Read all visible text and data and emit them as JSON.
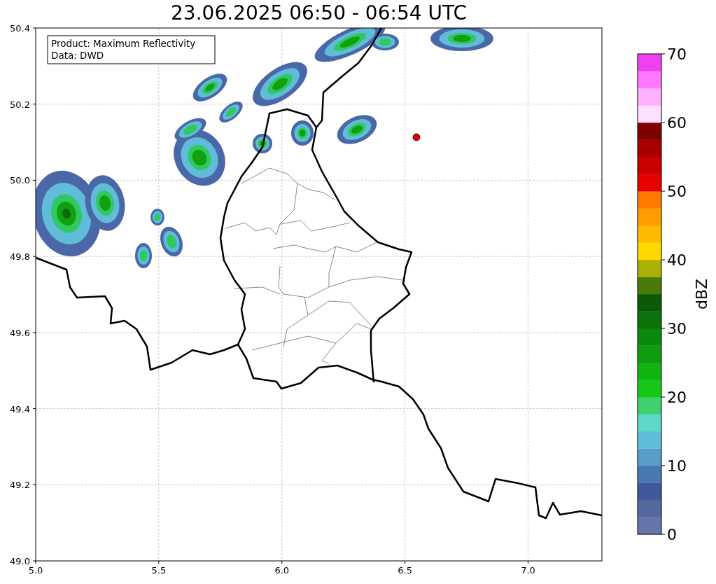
{
  "title": "23.06.2025 06:50 - 06:54 UTC",
  "legend": [
    "Product: Maximum Reflectivity",
    "Data: DWD"
  ],
  "x_axis": {
    "ticks": [
      "5.0",
      "5.5",
      "6.0",
      "6.5",
      "7.0"
    ]
  },
  "y_axis": {
    "ticks": [
      "50.4",
      "50.2",
      "50.0",
      "49.8",
      "49.6",
      "49.4",
      "49.2",
      "49.0"
    ]
  },
  "colorbar": {
    "label": "dBZ",
    "ticks": [
      "70",
      "60",
      "50",
      "40",
      "30",
      "20",
      "10",
      "0"
    ],
    "segments": [
      {
        "color": "#6477a8"
      },
      {
        "color": "#5469a0"
      },
      {
        "color": "#42589c"
      },
      {
        "color": "#4a78b0"
      },
      {
        "color": "#5a9ec8"
      },
      {
        "color": "#60bcd8"
      },
      {
        "color": "#60d8c8"
      },
      {
        "color": "#40d070"
      },
      {
        "color": "#18c818"
      },
      {
        "color": "#12b412"
      },
      {
        "color": "#109c10"
      },
      {
        "color": "#0c880c"
      },
      {
        "color": "#0c720c"
      },
      {
        "color": "#0a5a0a"
      },
      {
        "color": "#4a7a0a"
      },
      {
        "color": "#aab00a"
      },
      {
        "color": "#ffd800"
      },
      {
        "color": "#ffbb00"
      },
      {
        "color": "#ff9c00"
      },
      {
        "color": "#ff7a00"
      },
      {
        "color": "#e80000"
      },
      {
        "color": "#c80000"
      },
      {
        "color": "#a80000"
      },
      {
        "color": "#800000"
      },
      {
        "color": "#ffe0ff"
      },
      {
        "color": "#ffb0ff"
      },
      {
        "color": "#ff78ff"
      },
      {
        "color": "#f040f0"
      }
    ]
  }
}
